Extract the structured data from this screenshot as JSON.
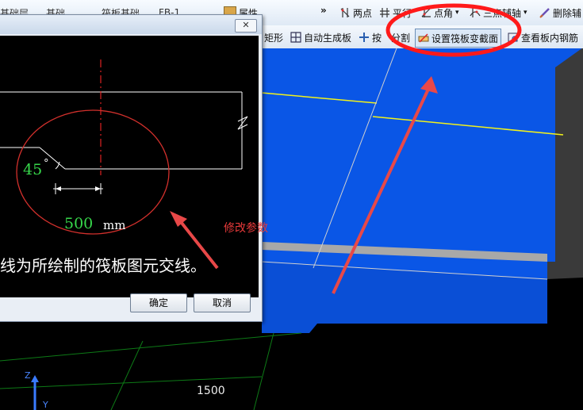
{
  "toolbar_top": {
    "overflow": "»",
    "tabs": [
      "基础层",
      "基础",
      "筏板基础",
      "FB-1"
    ],
    "attr": "属性",
    "items": [
      {
        "label": "两点",
        "icon": "two-point-icon"
      },
      {
        "label": "平行",
        "icon": "parallel-icon"
      },
      {
        "label": "点角",
        "icon": "point-angle-icon"
      },
      {
        "label": "三点辅轴",
        "icon": "three-point-axis-icon"
      },
      {
        "label": "删除辅",
        "icon": "delete-axis-icon"
      }
    ]
  },
  "toolbar_second": {
    "items": [
      {
        "label": "矩形"
      },
      {
        "label": "自动生成板"
      },
      {
        "label": "按"
      },
      {
        "label": "分割"
      },
      {
        "label": "设置筏板变截面"
      },
      {
        "label": "查看板内钢筋"
      }
    ]
  },
  "dialog": {
    "close": "✕",
    "angle": "45",
    "degree": "°",
    "dimension_value": "500",
    "dimension_unit": "mm",
    "caption": "线为所绘制的筏板图元交线。",
    "ok": "确定",
    "cancel": "取消"
  },
  "annotations": {
    "modify": "修改参数"
  },
  "viewport": {
    "dimension": "1500",
    "axis_z": "Z",
    "axis_y": "Y"
  },
  "colors": {
    "slab": "#0a56e6",
    "annotation": "#e83a3a",
    "dim_green": "#37d84b",
    "toolbar": "#dfe9f5"
  }
}
